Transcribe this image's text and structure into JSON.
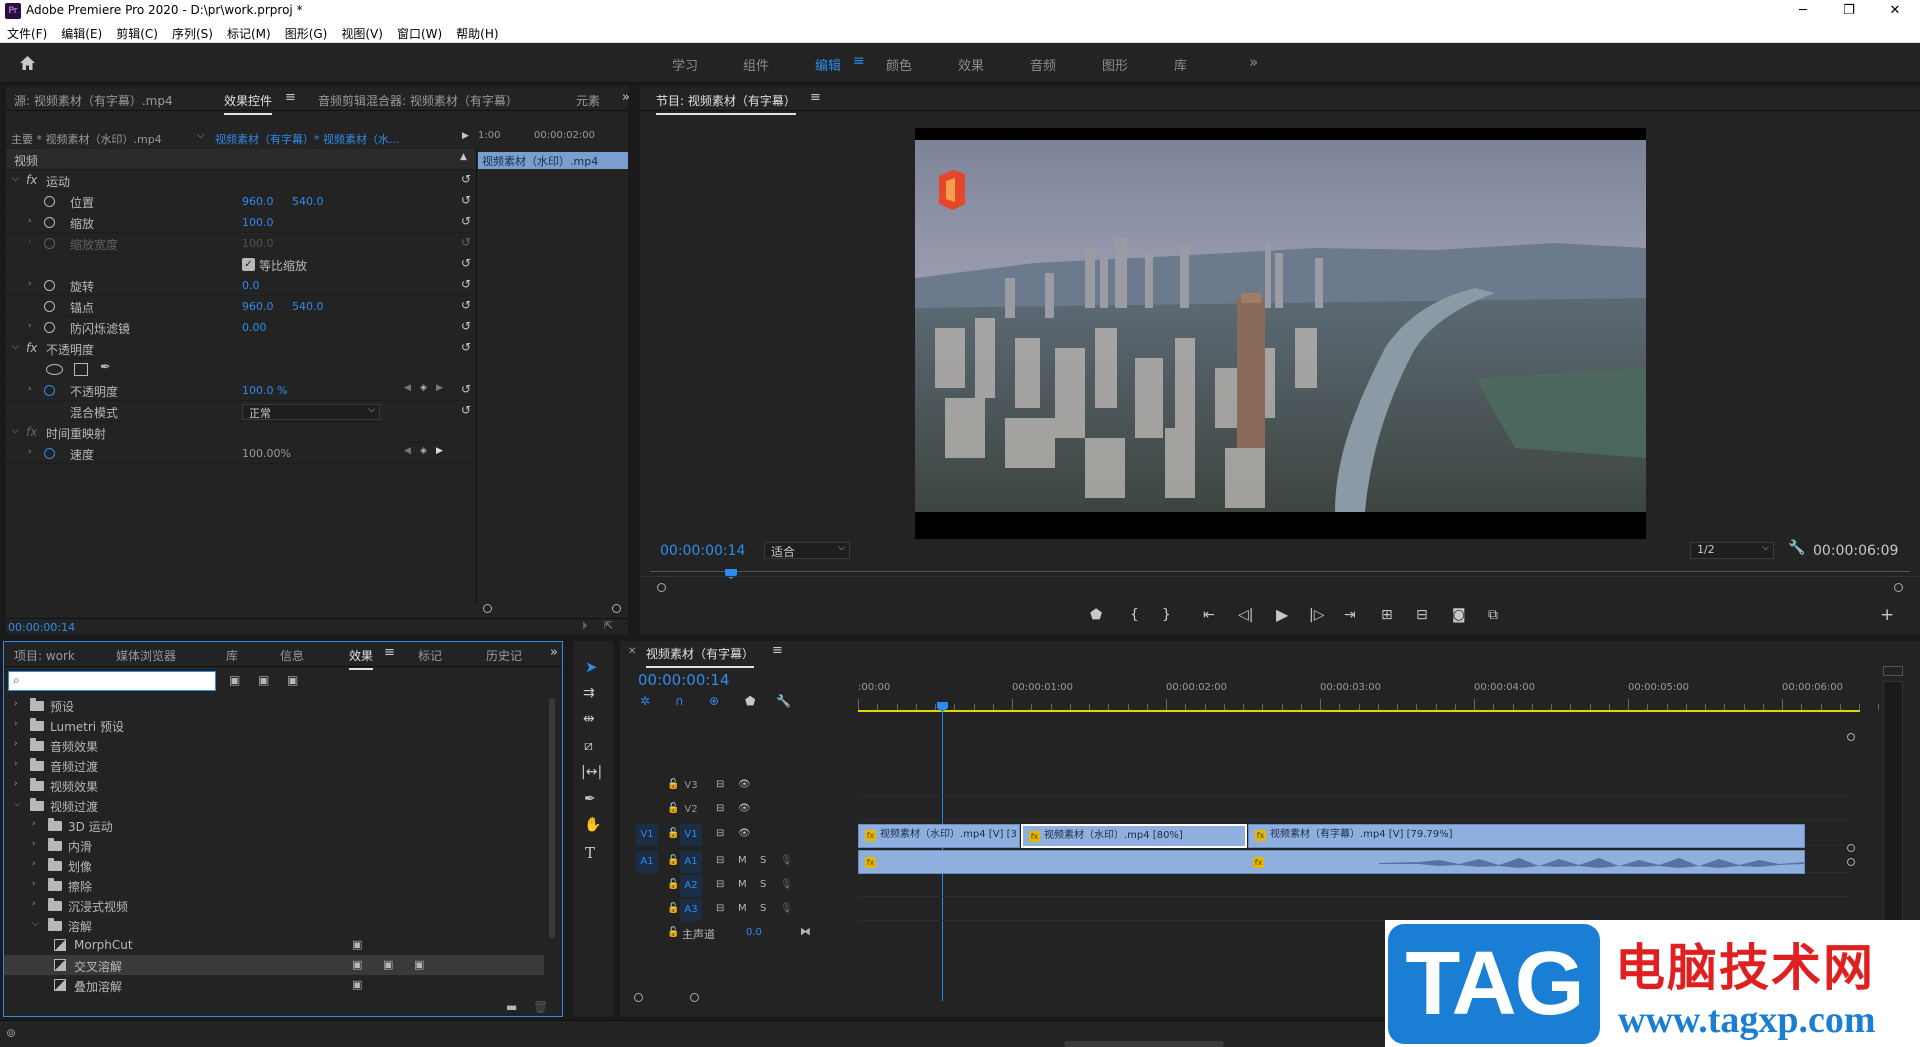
{
  "app": {
    "title": "Adobe Premiere Pro 2020 - D:\\pr\\work.prproj *",
    "logo": "Pr",
    "win_min": "─",
    "win_max": "❐",
    "win_close": "✕"
  },
  "menu": [
    "文件(F)",
    "编辑(E)",
    "剪辑(C)",
    "序列(S)",
    "标记(M)",
    "图形(G)",
    "视图(V)",
    "窗口(W)",
    "帮助(H)"
  ],
  "workspaces": {
    "items": [
      "学习",
      "组件",
      "编辑",
      "颜色",
      "效果",
      "音频",
      "图形",
      "库"
    ],
    "active": "编辑",
    "more": "»"
  },
  "effect_controls": {
    "tabs": [
      "源: 视频素材（有字幕）.mp4",
      "效果控件",
      "音频剪辑混合器: 视频素材（有字幕）",
      "元素"
    ],
    "active_tab": "效果控件",
    "master": "主要 * 视频素材（水印）.mp4",
    "clip": "视频素材（有字幕）* 视频素材（水...",
    "ruler_start": "1:00",
    "ruler_tc": "00:00:02:00",
    "clip_bar": "视频素材（水印）.mp4",
    "section_video": "视频",
    "motion": "运动",
    "rows": [
      {
        "label": "位置",
        "v1": "960.0",
        "v2": "540.0"
      },
      {
        "label": "缩放",
        "v1": "100.0",
        "v2": ""
      },
      {
        "label": "缩放宽度",
        "v1": "100.0",
        "v2": ""
      },
      {
        "label": "等比缩放",
        "v1": "",
        "v2": ""
      },
      {
        "label": "旋转",
        "v1": "0.0",
        "v2": ""
      },
      {
        "label": "锚点",
        "v1": "960.0",
        "v2": "540.0"
      },
      {
        "label": "防闪烁滤镜",
        "v1": "0.00",
        "v2": ""
      }
    ],
    "opacity_section": "不透明度",
    "opacity_label": "不透明度",
    "opacity_value": "100.0 %",
    "blend_label": "混合模式",
    "blend_value": "正常",
    "time_remap": "时间重映射",
    "speed_label": "速度",
    "speed_value": "100.00%",
    "timecode": "00:00:00:14"
  },
  "program": {
    "title": "节目: 视频素材（有字幕）",
    "timecode": "00:00:00:14",
    "fit": "适合",
    "resolution": "1/2",
    "duration": "00:00:06:09"
  },
  "project": {
    "tabs": [
      "项目: work",
      "媒体浏览器",
      "库",
      "信息",
      "效果",
      "标记",
      "历史记"
    ],
    "active_tab": "效果",
    "search_placeholder": "",
    "tree": [
      {
        "label": "预设",
        "level": 0,
        "open": false
      },
      {
        "label": "Lumetri 预设",
        "level": 0,
        "open": false
      },
      {
        "label": "音频效果",
        "level": 0,
        "open": false
      },
      {
        "label": "音频过渡",
        "level": 0,
        "open": false
      },
      {
        "label": "视频效果",
        "level": 0,
        "open": false
      },
      {
        "label": "视频过渡",
        "level": 0,
        "open": true
      },
      {
        "label": "3D 运动",
        "level": 1,
        "open": false
      },
      {
        "label": "内滑",
        "level": 1,
        "open": false
      },
      {
        "label": "划像",
        "level": 1,
        "open": false
      },
      {
        "label": "擦除",
        "level": 1,
        "open": false
      },
      {
        "label": "沉浸式视频",
        "level": 1,
        "open": false
      },
      {
        "label": "溶解",
        "level": 1,
        "open": true
      },
      {
        "label": "MorphCut",
        "level": 2,
        "item": true
      },
      {
        "label": "交叉溶解",
        "level": 2,
        "item": true,
        "selected": true
      },
      {
        "label": "叠加溶解",
        "level": 2,
        "item": true
      }
    ]
  },
  "timeline": {
    "title": "视频素材（有字幕）",
    "timecode": "00:00:00:14",
    "ruler": [
      ":00:00",
      "00:00:01:00",
      "00:00:02:00",
      "00:00:03:00",
      "00:00:04:00",
      "00:00:05:00",
      "00:00:06:00"
    ],
    "video_tracks": [
      "V3",
      "V2",
      "V1"
    ],
    "audio_tracks": [
      "A1",
      "A2",
      "A3"
    ],
    "master": "主声道",
    "master_value": "0.0",
    "src_v": "V1",
    "src_a": "A1",
    "clips": [
      {
        "label": "视频素材（水印）.mp4 [V] [3"
      },
      {
        "label": "视频素材（水印）.mp4 [80%]"
      },
      {
        "label": "视频素材（有字幕）.mp4 [V] [79.79%]"
      }
    ],
    "m": "M",
    "s": "S"
  },
  "watermark": {
    "tag": "TAG",
    "cn": "电脑技术网",
    "url": "www.tagxp.com"
  },
  "colors": {
    "accent": "#2d8ceb",
    "panel": "#232323",
    "clip": "#8fb0df",
    "playhead": "#2d8ceb"
  }
}
